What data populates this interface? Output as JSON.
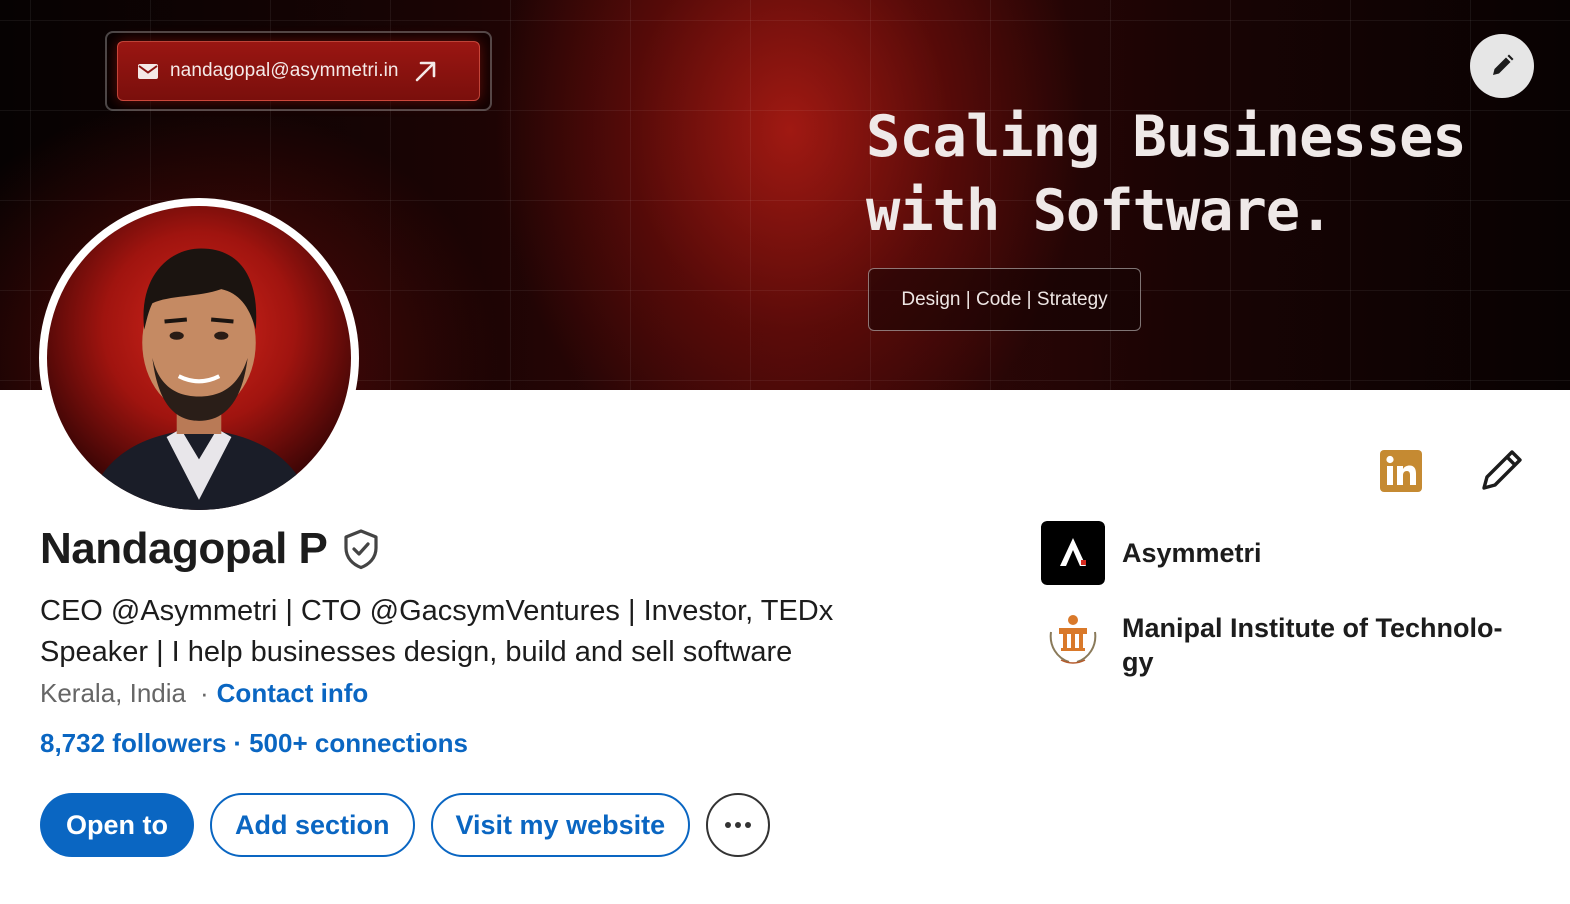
{
  "banner": {
    "email": "nandagopal@asymmetri.in",
    "headline_lines": [
      "Scaling Businesses",
      "with Software."
    ],
    "tagline": "Design | Code | Strategy"
  },
  "profile": {
    "name": "Nandagopal P",
    "headline": "CEO @Asymmetri | CTO @GacsymVentures | Investor, TEDx Speaker | I help businesses design, build and sell software",
    "location": "Kerala, India",
    "separator": "·",
    "contact_info": "Contact info",
    "followers": "8,732 followers",
    "connections": "500+ connections"
  },
  "actions": {
    "open_to": "Open to",
    "add_section": "Add section",
    "visit_website": "Visit my website"
  },
  "organizations": [
    {
      "name": "Asymmetri",
      "icon": "asymmetri-logo"
    },
    {
      "name": "Manipal Institute of Technolo-gy",
      "icon": "manipal-logo"
    }
  ],
  "colors": {
    "accent": "#0a66c2",
    "linkedin_badge": "#c58a32",
    "banner_red": "#a0140f"
  }
}
